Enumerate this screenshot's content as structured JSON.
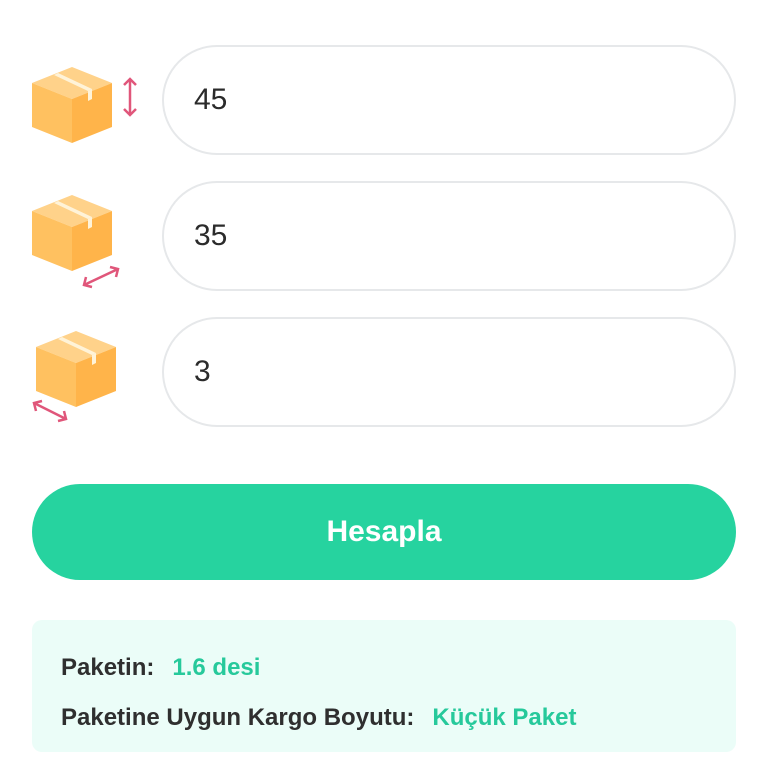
{
  "dimensions": [
    {
      "name": "height",
      "value": "45",
      "icon": "box-height-icon"
    },
    {
      "name": "width",
      "value": "35",
      "icon": "box-width-icon"
    },
    {
      "name": "length",
      "value": "3",
      "icon": "box-length-icon"
    }
  ],
  "button": {
    "label": "Hesapla"
  },
  "result": {
    "package_label": "Paketin:",
    "package_value": "1.6 desi",
    "size_label": "Paketine Uygun Kargo Boyutu:",
    "size_value": "Küçük Paket"
  },
  "colors": {
    "accent": "#26d39f",
    "result_bg": "#ebfdf8",
    "box_fill": "#ffc86e",
    "arrow": "#e0567a"
  }
}
